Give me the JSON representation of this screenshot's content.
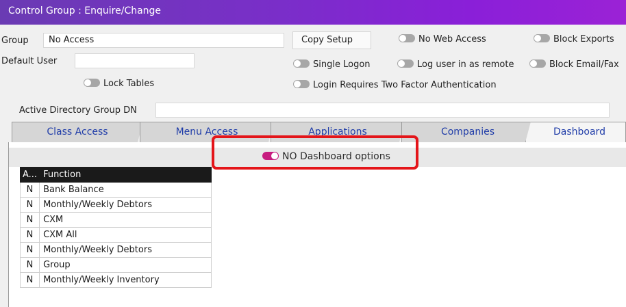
{
  "window": {
    "title": "Control Group : Enquire/Change"
  },
  "form": {
    "group_label": "Group",
    "group_value": "No Access",
    "default_user_label": "Default User",
    "default_user_value": "",
    "copy_setup_label": "Copy Setup",
    "lock_tables_label": "Lock Tables",
    "no_web_access_label": "No Web Access",
    "block_exports_label": "Block Exports",
    "single_logon_label": "Single Logon",
    "log_user_remote_label": "Log user in as remote",
    "block_email_fax_label": "Block Email/Fax",
    "two_factor_label": "Login Requires Two Factor Authentication",
    "ad_group_label": "Active Directory Group DN",
    "ad_group_value": ""
  },
  "tabs": [
    {
      "label": "Class Access"
    },
    {
      "label": "Menu Access"
    },
    {
      "label": "Applications"
    },
    {
      "label": "Companies"
    },
    {
      "label": "Dashboard"
    }
  ],
  "dashboard": {
    "no_options_label": "NO Dashboard options",
    "no_options_on": true,
    "table": {
      "headers": [
        "A...",
        "Function"
      ],
      "rows": [
        {
          "access": "N",
          "function": "Bank Balance"
        },
        {
          "access": "N",
          "function": "Monthly/Weekly Debtors"
        },
        {
          "access": "N",
          "function": "CXM"
        },
        {
          "access": "N",
          "function": "CXM All"
        },
        {
          "access": "N",
          "function": "Monthly/Weekly Debtors"
        },
        {
          "access": "N",
          "function": "Group"
        },
        {
          "access": "N",
          "function": "Monthly/Weekly Inventory"
        }
      ]
    }
  },
  "colors": {
    "title_gradient_start": "#6a3bb3",
    "title_gradient_end": "#9b22d6",
    "toggle_on": "#c4117a",
    "highlight": "#e4151a",
    "tab_text": "#1f3ca8"
  }
}
